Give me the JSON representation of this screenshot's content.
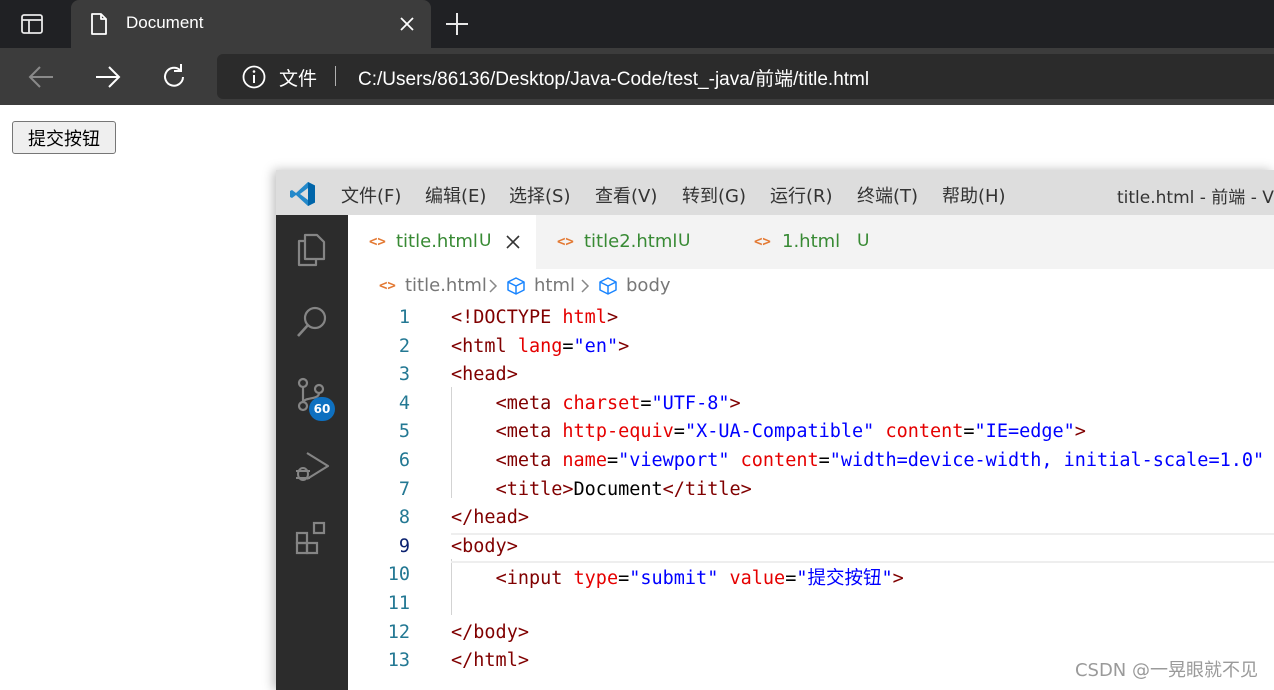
{
  "browser": {
    "tab_title": "Document",
    "address_label": "文件",
    "address_url": "C:/Users/86136/Desktop/Java-Code/test_-java/前端/title.html"
  },
  "page": {
    "submit_button_label": "提交按钮"
  },
  "vscode": {
    "menu": [
      "文件(F)",
      "编辑(E)",
      "选择(S)",
      "查看(V)",
      "转到(G)",
      "运行(R)",
      "终端(T)",
      "帮助(H)"
    ],
    "window_title": "title.html - 前端 - Vi",
    "source_control_badge": "60",
    "tabs": [
      {
        "label": "title.html",
        "status": "U",
        "active": true
      },
      {
        "label": "title2.html",
        "status": "U",
        "active": false
      },
      {
        "label": "1.html",
        "status": "U",
        "active": false
      }
    ],
    "breadcrumb": [
      "title.html",
      "html",
      "body"
    ],
    "code_line_numbers": [
      "1",
      "2",
      "3",
      "4",
      "5",
      "6",
      "7",
      "8",
      "9",
      "10",
      "11",
      "12",
      "13"
    ],
    "current_line": 9
  },
  "watermark": "CSDN @一晃眼就不见",
  "colors": {
    "tag": "#800000",
    "attribute": "#e50000",
    "string": "#0000ff",
    "line_number": "#237893",
    "tab_modified": "#388a34",
    "badge": "#0e70c0"
  }
}
